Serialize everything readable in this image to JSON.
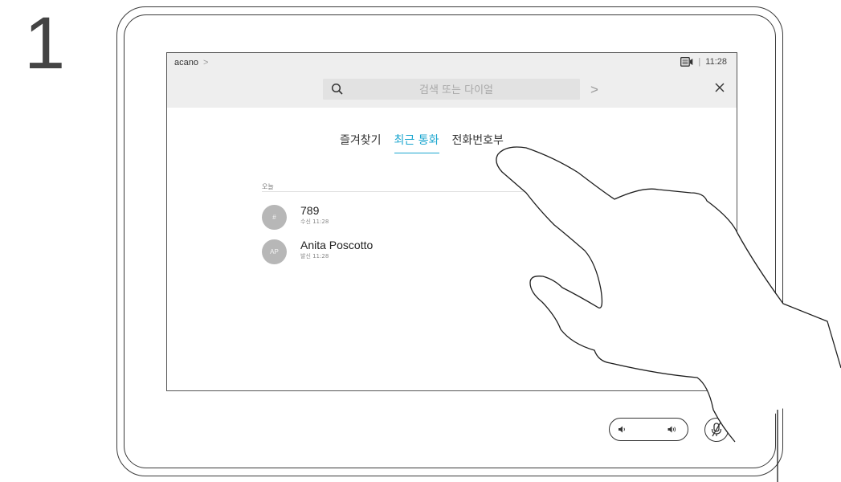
{
  "step": {
    "number": "1"
  },
  "header": {
    "breadcrumb": "acano",
    "breadcrumb_chevron": ">",
    "separator": "|",
    "time": "11:28"
  },
  "search": {
    "placeholder": "검색 또는 다이얼",
    "next_chevron": ">"
  },
  "tabs": [
    {
      "label": "즐겨찾기",
      "active": false
    },
    {
      "label": "최근 통화",
      "active": true
    },
    {
      "label": "전화번호부",
      "active": false
    }
  ],
  "recents": {
    "section_label": "오늘",
    "items": [
      {
        "avatar": "#",
        "name": "789",
        "meta": "수신 11:28"
      },
      {
        "avatar": "AP",
        "name": "Anita Poscotto",
        "meta": "발신 11:28"
      }
    ]
  },
  "icons": {
    "camera": "camera-icon",
    "search": "search-icon",
    "close": "close-icon",
    "volume_down": "volume-down-icon",
    "volume_up": "volume-up-icon",
    "mute": "microphone-mute-icon"
  },
  "colors": {
    "accent": "#1ba6cf",
    "topbar": "#eeeeee",
    "avatar": "#b7b7b7"
  }
}
